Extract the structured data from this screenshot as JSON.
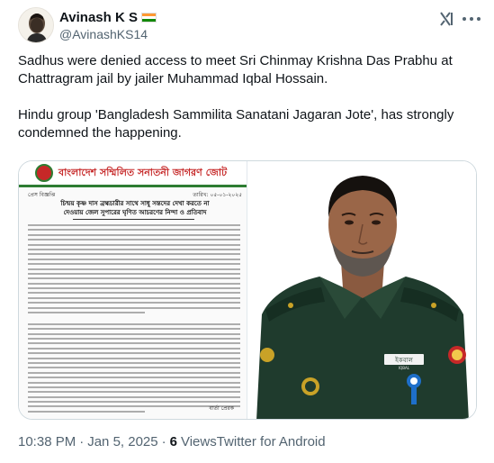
{
  "author": {
    "display_name": "Avinash K S",
    "handle": "@AvinashKS14",
    "flag_colors": [
      "#ff9933",
      "#ffffff",
      "#138808"
    ]
  },
  "header_icons": {
    "grok": "grok-icon",
    "more": "more-options-icon"
  },
  "tweet": {
    "paragraphs": [
      "Sadhus were denied access to meet Sri Chinmay Krishna Das Prabhu at Chattragram jail by jailer Muhammad Iqbal Hossain.",
      "Hindu group 'Bangladesh Sammilita Sanatani Jagaran Jote', has strongly condemned the happening."
    ]
  },
  "media": {
    "document": {
      "title": "বাংলাদেশ সম্মিলিত সনাতনী জাগরণ জোট",
      "label": "প্রেস বিজ্ঞপ্তি",
      "date": "তারিখ: ০৫-০১-২০২৫",
      "subject_line_1": "চিন্ময় কৃষ্ণ দাস ব্রহ্মচারীর সাথে সাধু সন্তদের দেখা করতে না",
      "subject_line_2": "দেওয়ায় জেল সুপারের ঘৃণিত আচরণের নিন্দা ও প্রতিবাদ",
      "signature": "বার্তা প্রেরক"
    },
    "photo": {
      "name_tag": "ইকবাল",
      "name_tag_latin": "IQBAL"
    }
  },
  "footer": {
    "time": "10:38 PM",
    "separator": "·",
    "date": "Jan 5, 2025",
    "views_count": "6",
    "views_label": "Views",
    "source": "Twitter for Android"
  },
  "colors": {
    "text_primary": "#0f1419",
    "text_secondary": "#536471",
    "border": "#cfd9de",
    "doc_red": "#c62828",
    "doc_green": "#2e7d32",
    "uniform_green": "#1f3b2d"
  }
}
